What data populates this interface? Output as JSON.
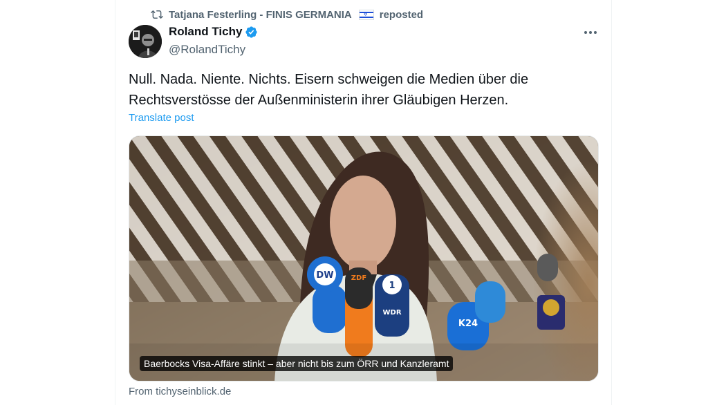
{
  "repost": {
    "user": "Tatjana Festerling - FINIS GERMANIA",
    "flag_icon": "israel-flag-emoji",
    "label": "reposted"
  },
  "tweet": {
    "author_name": "Roland Tichy",
    "verified": true,
    "handle": "@RolandTichy",
    "text_line1": "Null. Nada. Niente. Nichts. Eisern schweigen die Medien über die",
    "text_line2": "Rechtsverstösse der Außenministerin ihrer Gläubigen Herzen.",
    "translate_label": "Translate post",
    "more_icon": "ellipsis-icon"
  },
  "card": {
    "caption": "Baerbocks Visa-Affäre stinkt – aber nicht bis zum ÖRR und Kanzleramt",
    "source": "From tichyseinblick.de",
    "mic_labels": [
      "DW",
      "ZDF",
      "WDR",
      "K24"
    ]
  },
  "colors": {
    "accent": "#1d9bf0",
    "secondary_text": "#536471",
    "primary_text": "#0f1419"
  }
}
